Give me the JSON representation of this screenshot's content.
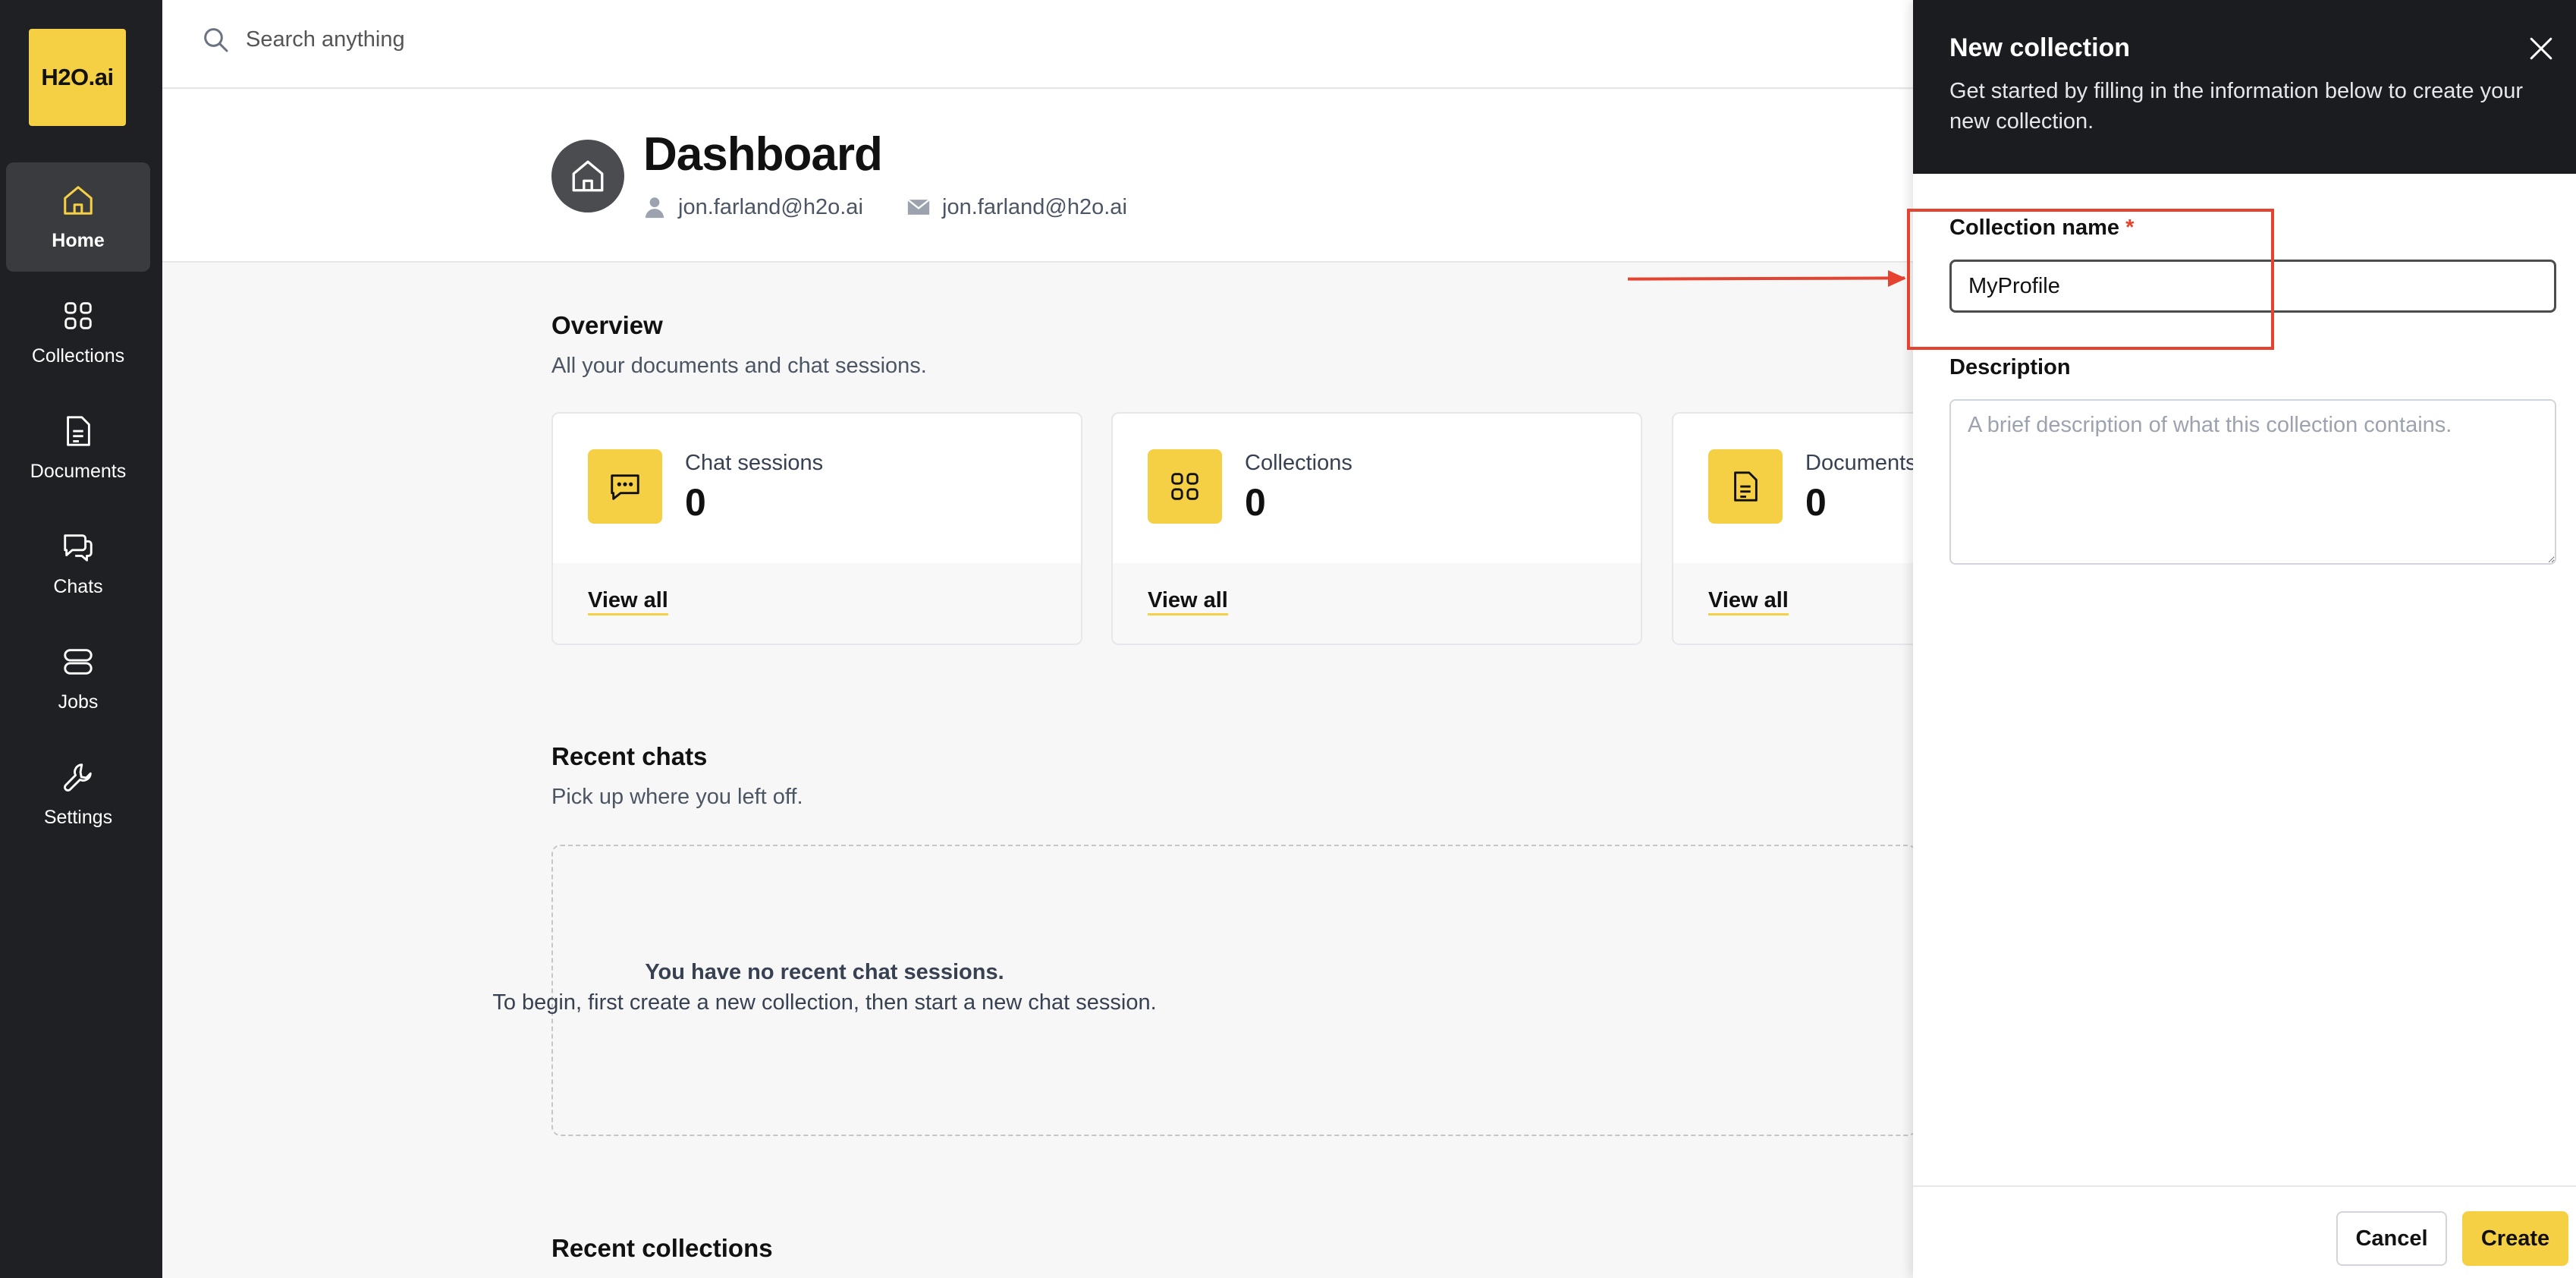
{
  "app": {
    "logo_text": "H2O.ai"
  },
  "sidebar": {
    "items": [
      {
        "label": "Home",
        "icon": "home-icon",
        "active": true
      },
      {
        "label": "Collections",
        "icon": "grid-icon"
      },
      {
        "label": "Documents",
        "icon": "document-icon"
      },
      {
        "label": "Chats",
        "icon": "chat-icon"
      },
      {
        "label": "Jobs",
        "icon": "server-icon"
      },
      {
        "label": "Settings",
        "icon": "wrench-icon"
      }
    ]
  },
  "search": {
    "placeholder": "Search anything"
  },
  "header": {
    "title": "Dashboard",
    "username": "jon.farland@h2o.ai",
    "email": "jon.farland@h2o.ai"
  },
  "overview": {
    "title": "Overview",
    "subtitle": "All your documents and chat sessions.",
    "cards": [
      {
        "label": "Chat sessions",
        "value": "0",
        "link": "View all",
        "icon": "chat-bubble-icon"
      },
      {
        "label": "Collections",
        "value": "0",
        "link": "View all",
        "icon": "grid-icon"
      },
      {
        "label": "Documents",
        "value": "0",
        "link": "View all",
        "icon": "document-icon"
      }
    ]
  },
  "recent_chats": {
    "title": "Recent chats",
    "subtitle": "Pick up where you left off.",
    "empty_title": "You have no recent chat sessions.",
    "empty_subtitle": "To begin, first create a new collection, then start a new chat session."
  },
  "recent_collections": {
    "title": "Recent collections"
  },
  "drawer": {
    "title": "New collection",
    "description": "Get started by filling in the information below to create your new collection.",
    "name_label": "Collection name",
    "name_required": "*",
    "name_value": "MyProfile",
    "description_label": "Description",
    "description_placeholder": "A brief description of what this collection contains.",
    "cancel_label": "Cancel",
    "create_label": "Create"
  },
  "colors": {
    "accent": "#f5cf44",
    "sidebar_bg": "#1f2023",
    "annotation": "#e5432f"
  }
}
